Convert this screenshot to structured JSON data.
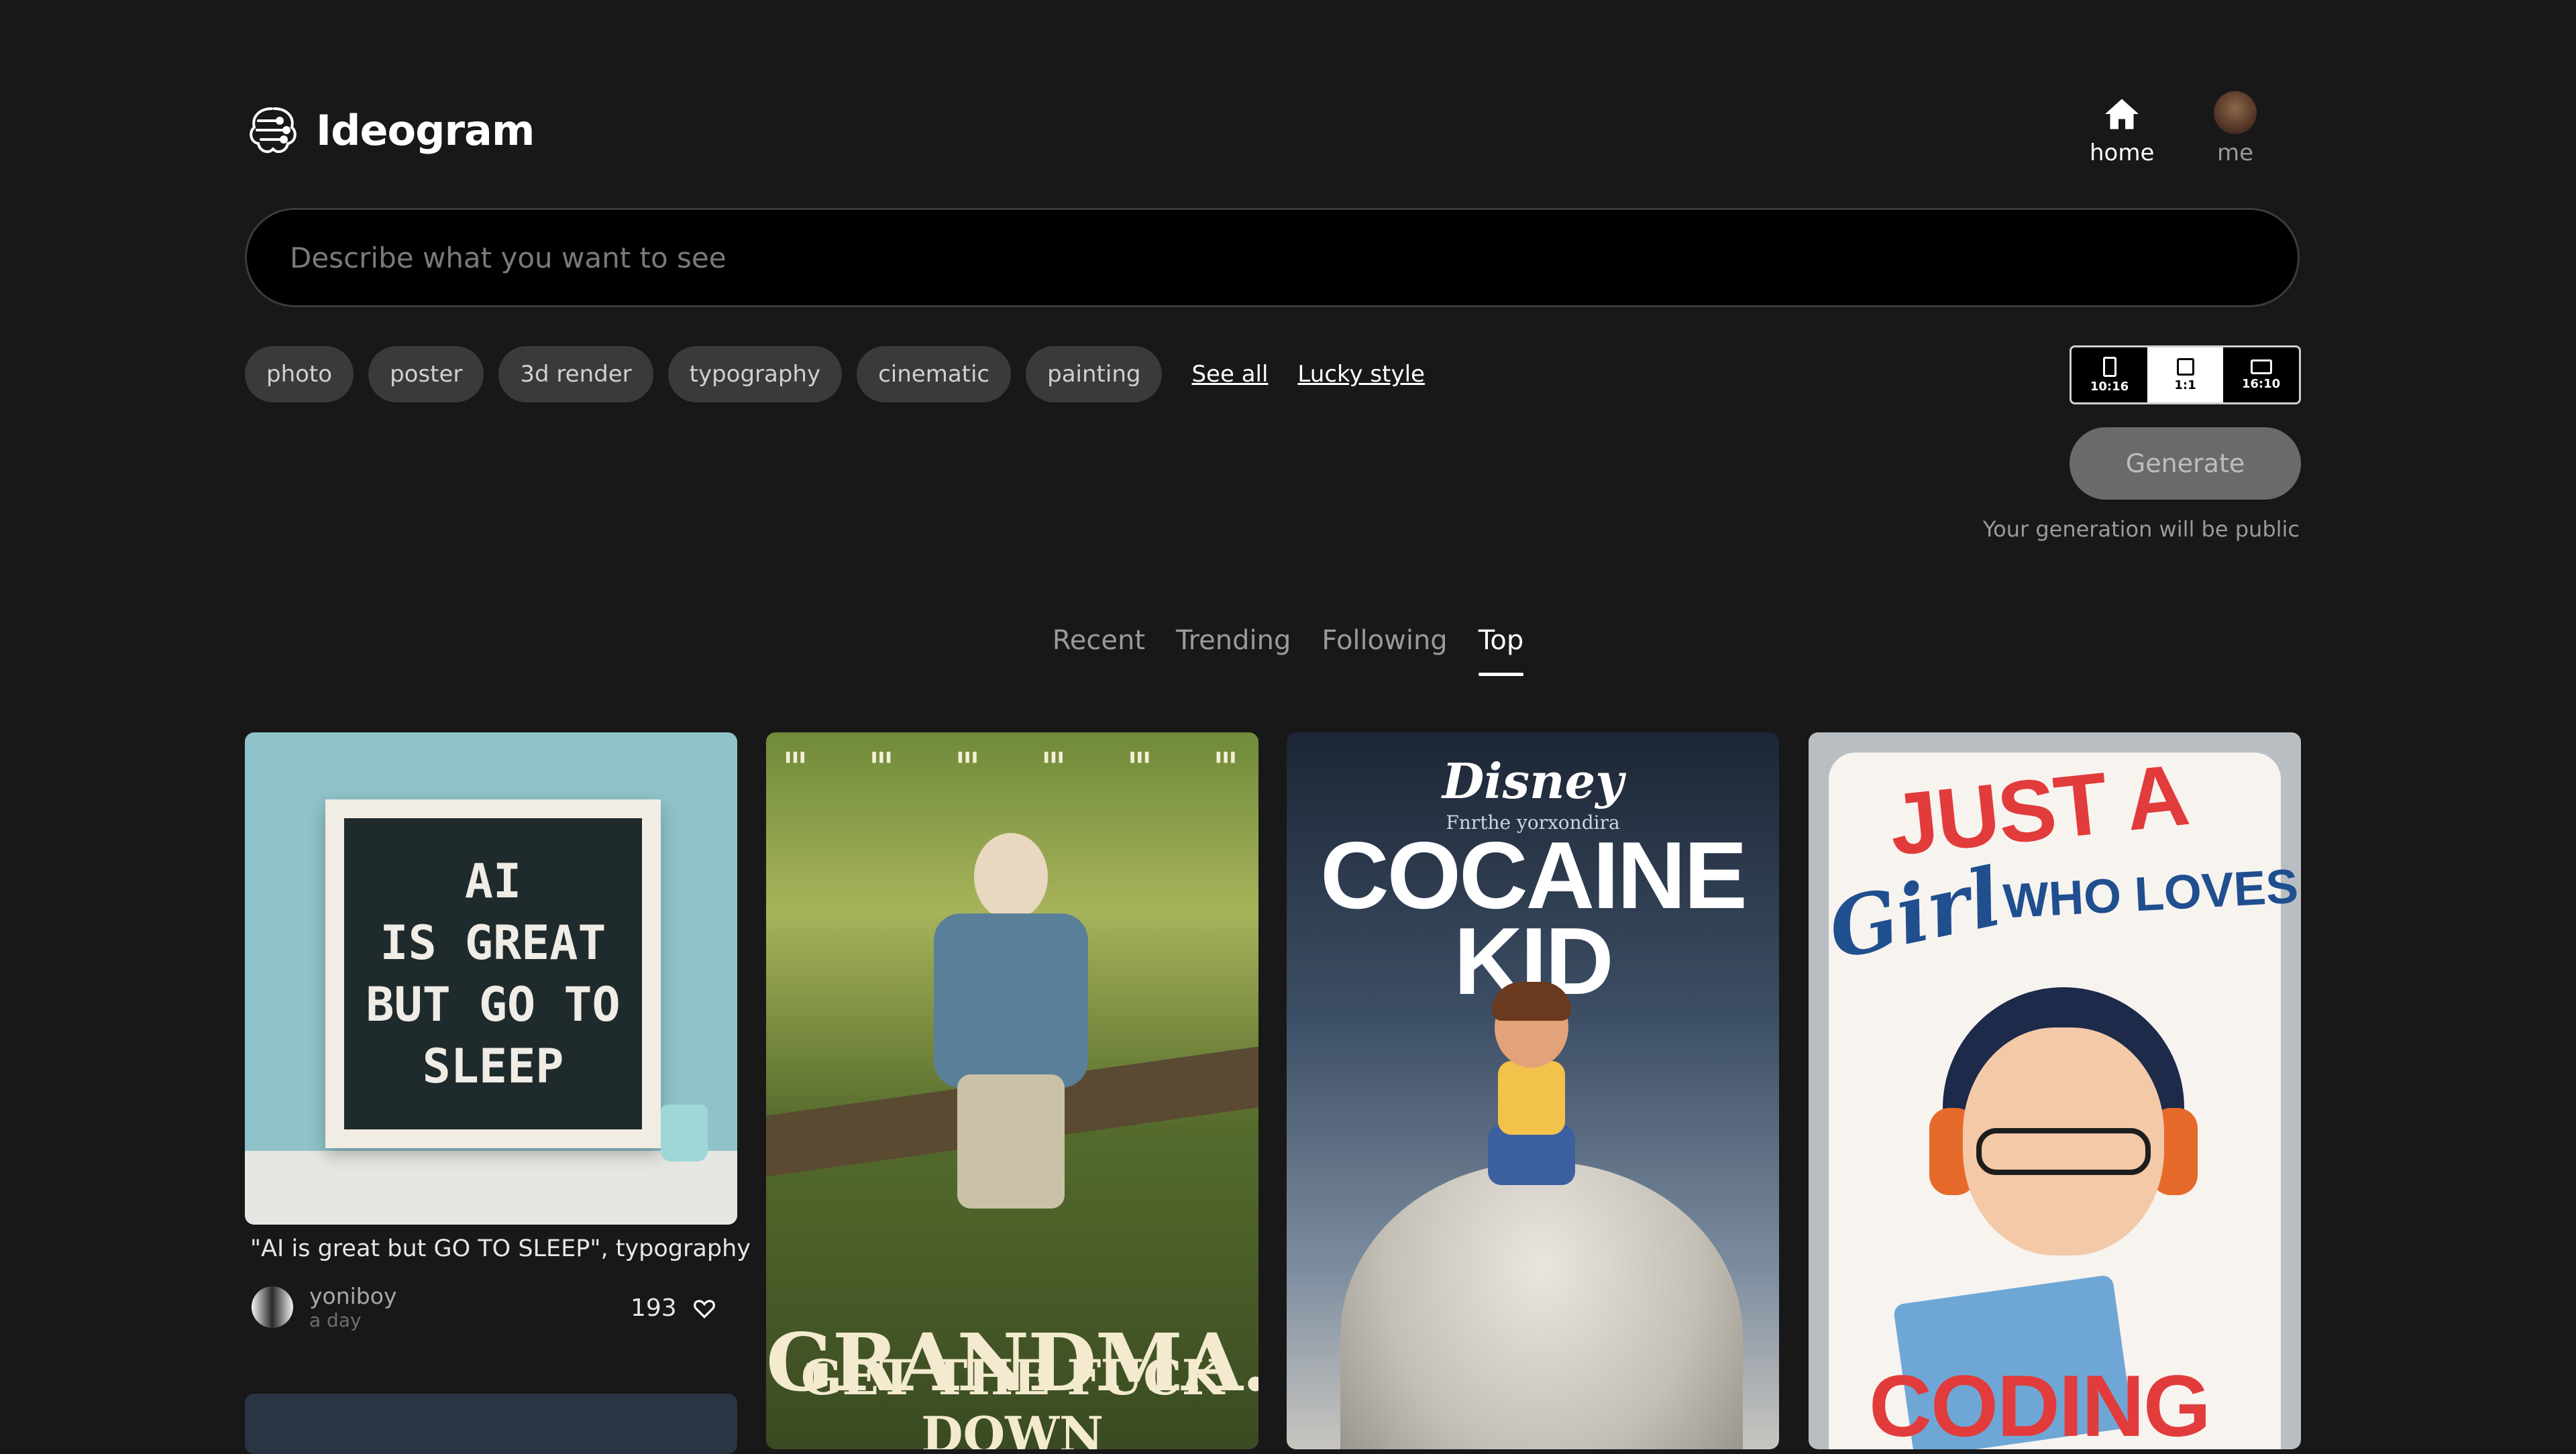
{
  "header": {
    "brand": "Ideogram",
    "nav": [
      {
        "label": "home",
        "icon": "home-icon"
      },
      {
        "label": "me",
        "icon": "avatar"
      }
    ]
  },
  "search": {
    "placeholder": "Describe what you want to see",
    "value": ""
  },
  "styles": {
    "chips": [
      "photo",
      "poster",
      "3d render",
      "typography",
      "cinematic",
      "painting"
    ],
    "see_all": "See all",
    "lucky": "Lucky style"
  },
  "aspect_ratios": {
    "options": [
      "10:16",
      "1:1",
      "16:10"
    ],
    "selected": "1:1"
  },
  "generate": {
    "label": "Generate",
    "note": "Your generation will be public"
  },
  "feed_tabs": {
    "items": [
      "Recent",
      "Trending",
      "Following",
      "Top"
    ],
    "active": "Top"
  },
  "cards": [
    {
      "image_text": [
        "AI",
        "IS GREAT",
        "BUT GO TO",
        "SLEEP"
      ],
      "caption": "\"AI is great but GO TO SLEEP\", typography",
      "author": "yoniboy",
      "time": "a day",
      "likes": "193"
    },
    {
      "image_title": "GRANDMA.",
      "image_subtitle": "GET THE FUCK DOWN"
    },
    {
      "brand": "Disney",
      "subtitle": "Fnrthe yorxondira",
      "title": "COCAINE KID"
    },
    {
      "text_top": "JUST A",
      "text_script": "Girl",
      "text_mid": "WHO LOVES",
      "text_bottom": "CODING"
    }
  ],
  "colors": {
    "background": "#181818",
    "search_bg": "#000000",
    "chip_bg": "#3a3a3a",
    "generate_bg": "#6a6a6a",
    "tab_inactive": "#9a9a9a",
    "tab_active": "#ffffff"
  }
}
